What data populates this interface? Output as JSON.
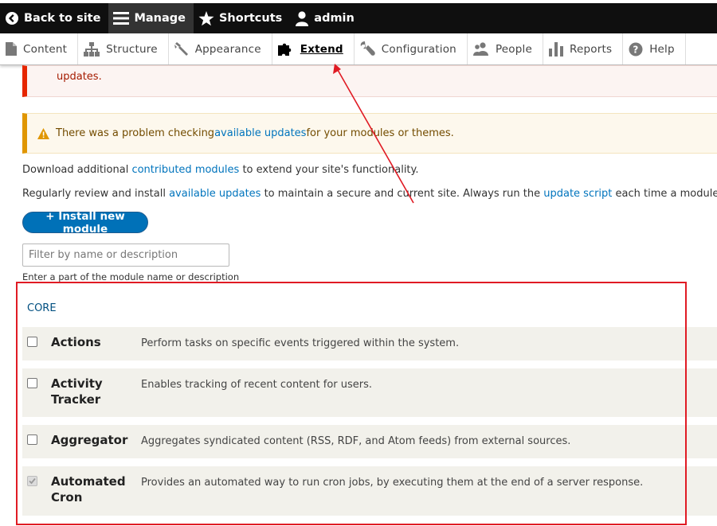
{
  "toolbar": {
    "back": "Back to site",
    "manage": "Manage",
    "shortcuts": "Shortcuts",
    "user": "admin"
  },
  "tray": {
    "items": [
      "Content",
      "Structure",
      "Appearance",
      "Extend",
      "Configuration",
      "People",
      "Reports",
      "Help"
    ],
    "active": "Extend"
  },
  "messages": {
    "error_tail": "updates.",
    "warning": {
      "pre": "There was a problem checking ",
      "link": "available updates",
      "post": " for your modules or themes."
    }
  },
  "intro": {
    "line1": {
      "pre": "Download additional ",
      "link": "contributed modules",
      "post": " to extend your site's functionality."
    },
    "line2": {
      "pre": "Regularly review and install ",
      "link1": "available updates",
      "mid": " to maintain a secure and current site. Always run the ",
      "link2": "update script",
      "post": " each time a module is up"
    }
  },
  "install_button": "+ Install new module",
  "filter": {
    "placeholder": "Filter by name or description",
    "description": "Enter a part of the module name or description"
  },
  "core": {
    "legend": "CORE",
    "modules": [
      {
        "name": "Actions",
        "description": "Perform tasks on specific events triggered within the system.",
        "checked": false
      },
      {
        "name": "Activity Tracker",
        "description": "Enables tracking of recent content for users.",
        "checked": false
      },
      {
        "name": "Aggregator",
        "description": "Aggregates syndicated content (RSS, RDF, and Atom feeds) from external sources.",
        "checked": false
      },
      {
        "name": "Automated Cron",
        "description": "Provides an automated way to run cron jobs, by executing them at the end of a server response.",
        "checked": true
      }
    ]
  },
  "colors": {
    "toolbar_bg": "#0f0f0f",
    "link": "#0074bd",
    "button": "#0071b8",
    "annotation": "#e01b24",
    "error_border": "#e62600",
    "warning_border": "#e09600"
  }
}
